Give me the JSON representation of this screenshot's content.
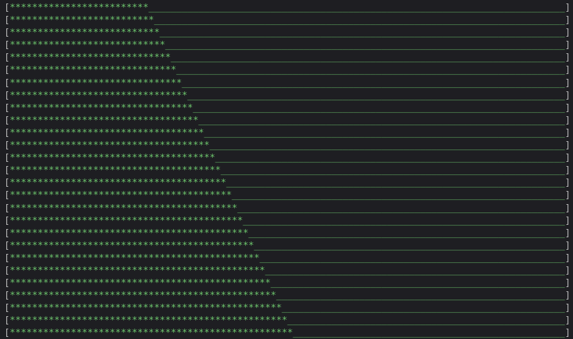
{
  "terminal": {
    "background": "#1e1e22",
    "bar_color": "#6cc46c",
    "bracket_color": "#b9b9b9",
    "open_bracket": "[",
    "close_bracket": "]",
    "fill_char": "*",
    "empty_char": "_",
    "bar_width_chars": 100,
    "progress_bars": [
      {
        "filled": 25,
        "empty": 75
      },
      {
        "filled": 26,
        "empty": 74
      },
      {
        "filled": 27,
        "empty": 73
      },
      {
        "filled": 28,
        "empty": 72
      },
      {
        "filled": 29,
        "empty": 71
      },
      {
        "filled": 30,
        "empty": 70
      },
      {
        "filled": 31,
        "empty": 69
      },
      {
        "filled": 32,
        "empty": 68
      },
      {
        "filled": 33,
        "empty": 67
      },
      {
        "filled": 34,
        "empty": 66
      },
      {
        "filled": 35,
        "empty": 65
      },
      {
        "filled": 36,
        "empty": 64
      },
      {
        "filled": 37,
        "empty": 63
      },
      {
        "filled": 38,
        "empty": 62
      },
      {
        "filled": 39,
        "empty": 61
      },
      {
        "filled": 40,
        "empty": 60
      },
      {
        "filled": 41,
        "empty": 59
      },
      {
        "filled": 42,
        "empty": 58
      },
      {
        "filled": 43,
        "empty": 57
      },
      {
        "filled": 44,
        "empty": 56
      },
      {
        "filled": 45,
        "empty": 55
      },
      {
        "filled": 46,
        "empty": 54
      },
      {
        "filled": 47,
        "empty": 53
      },
      {
        "filled": 48,
        "empty": 52
      },
      {
        "filled": 49,
        "empty": 51
      },
      {
        "filled": 50,
        "empty": 50
      },
      {
        "filled": 51,
        "empty": 49
      }
    ]
  }
}
